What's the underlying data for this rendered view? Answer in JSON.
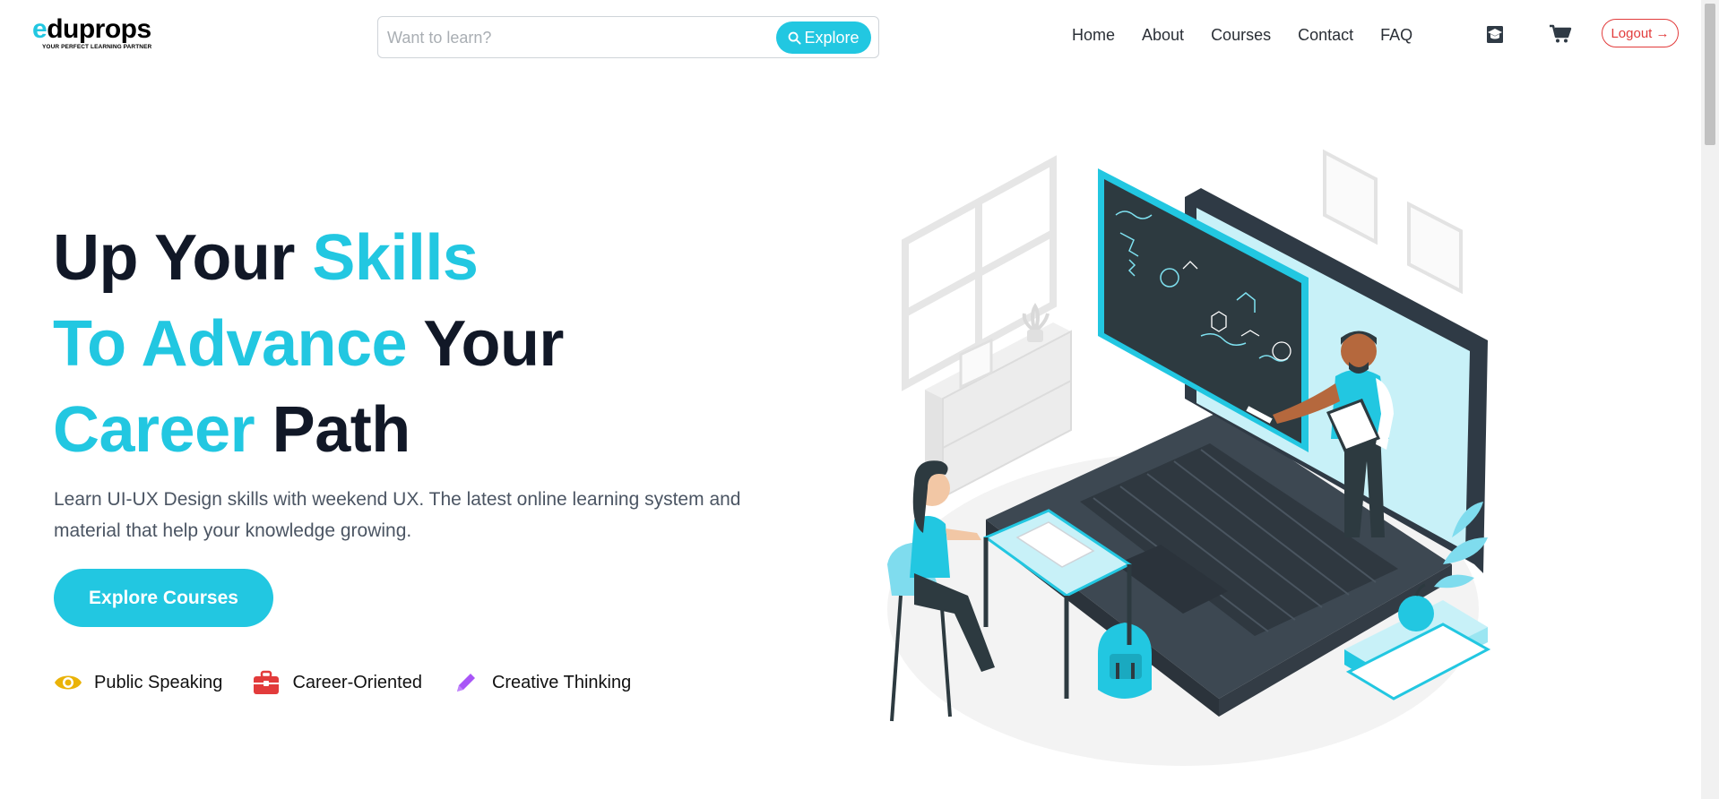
{
  "header": {
    "logo": {
      "mark": "e",
      "name": "duprops",
      "tagline": "YOUR PERFECT LEARNING PARTNER"
    },
    "search": {
      "placeholder": "Want to learn?",
      "value": "",
      "button_label": "Explore"
    },
    "nav": [
      {
        "label": "Home"
      },
      {
        "label": "About"
      },
      {
        "label": "Courses"
      },
      {
        "label": "Contact"
      },
      {
        "label": "FAQ"
      }
    ],
    "icons": [
      "graduation-cap-icon",
      "cart-icon"
    ],
    "logout_label": "Logout →"
  },
  "hero": {
    "title": {
      "line1": {
        "dark": "Up Your ",
        "accent": "Skills"
      },
      "line2": {
        "accent": "To Advance ",
        "dark": "Your"
      },
      "line3": {
        "accent": "Career ",
        "dark": "Path"
      }
    },
    "description": "Learn UI-UX Design skills with weekend UX. The latest online learning system and material that help your knowledge growing.",
    "cta_label": "Explore Courses",
    "features": [
      {
        "icon": "eye-icon",
        "label": "Public Speaking",
        "color": "#eab308"
      },
      {
        "icon": "briefcase-icon",
        "label": "Career-Oriented",
        "color": "#e23b3b"
      },
      {
        "icon": "pencil-icon",
        "label": "Creative Thinking",
        "color": "#a855f7"
      }
    ]
  },
  "colors": {
    "accent": "#22c7e1",
    "text_dark": "#111827",
    "text_body": "#4b5563",
    "logout": "#e23b3b"
  }
}
